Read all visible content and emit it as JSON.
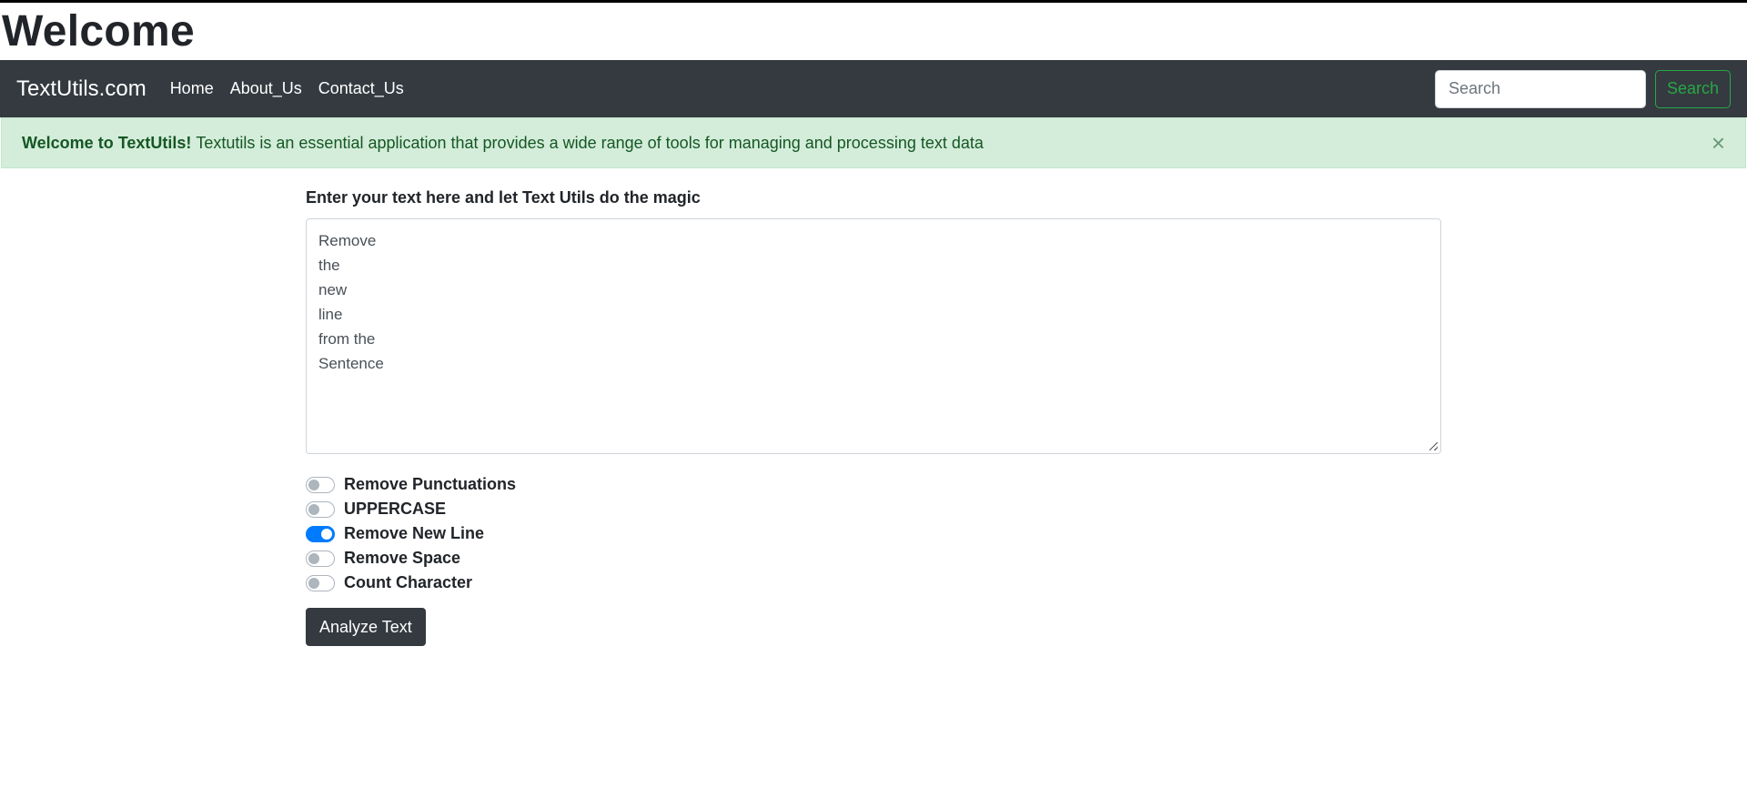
{
  "page": {
    "title": "Welcome"
  },
  "navbar": {
    "brand": "TextUtils.com",
    "links": [
      "Home",
      "About_Us",
      "Contact_Us"
    ],
    "search_placeholder": "Search",
    "search_button": "Search"
  },
  "alert": {
    "strong": "Welcome to TextUtils!",
    "message": "Textutils is an essential application that provides a wide range of tools for managing and processing text data",
    "close": "×"
  },
  "form": {
    "label": "Enter your text here and let Text Utils do the magic",
    "text_lines": [
      "Remove",
      "the",
      "new",
      "line",
      "from the",
      "Sentence"
    ],
    "switches": [
      {
        "label": "Remove Punctuations",
        "checked": false
      },
      {
        "label": "UPPERCASE",
        "checked": false
      },
      {
        "label": "Remove New Line",
        "checked": true
      },
      {
        "label": "Remove Space",
        "checked": false
      },
      {
        "label": "Count Character",
        "checked": false
      }
    ],
    "submit_label": "Analyze Text"
  },
  "colors": {
    "navbar_bg": "#343a40",
    "alert_bg": "#d4edda",
    "alert_text": "#155724",
    "success": "#28a745",
    "primary": "#007bff"
  }
}
